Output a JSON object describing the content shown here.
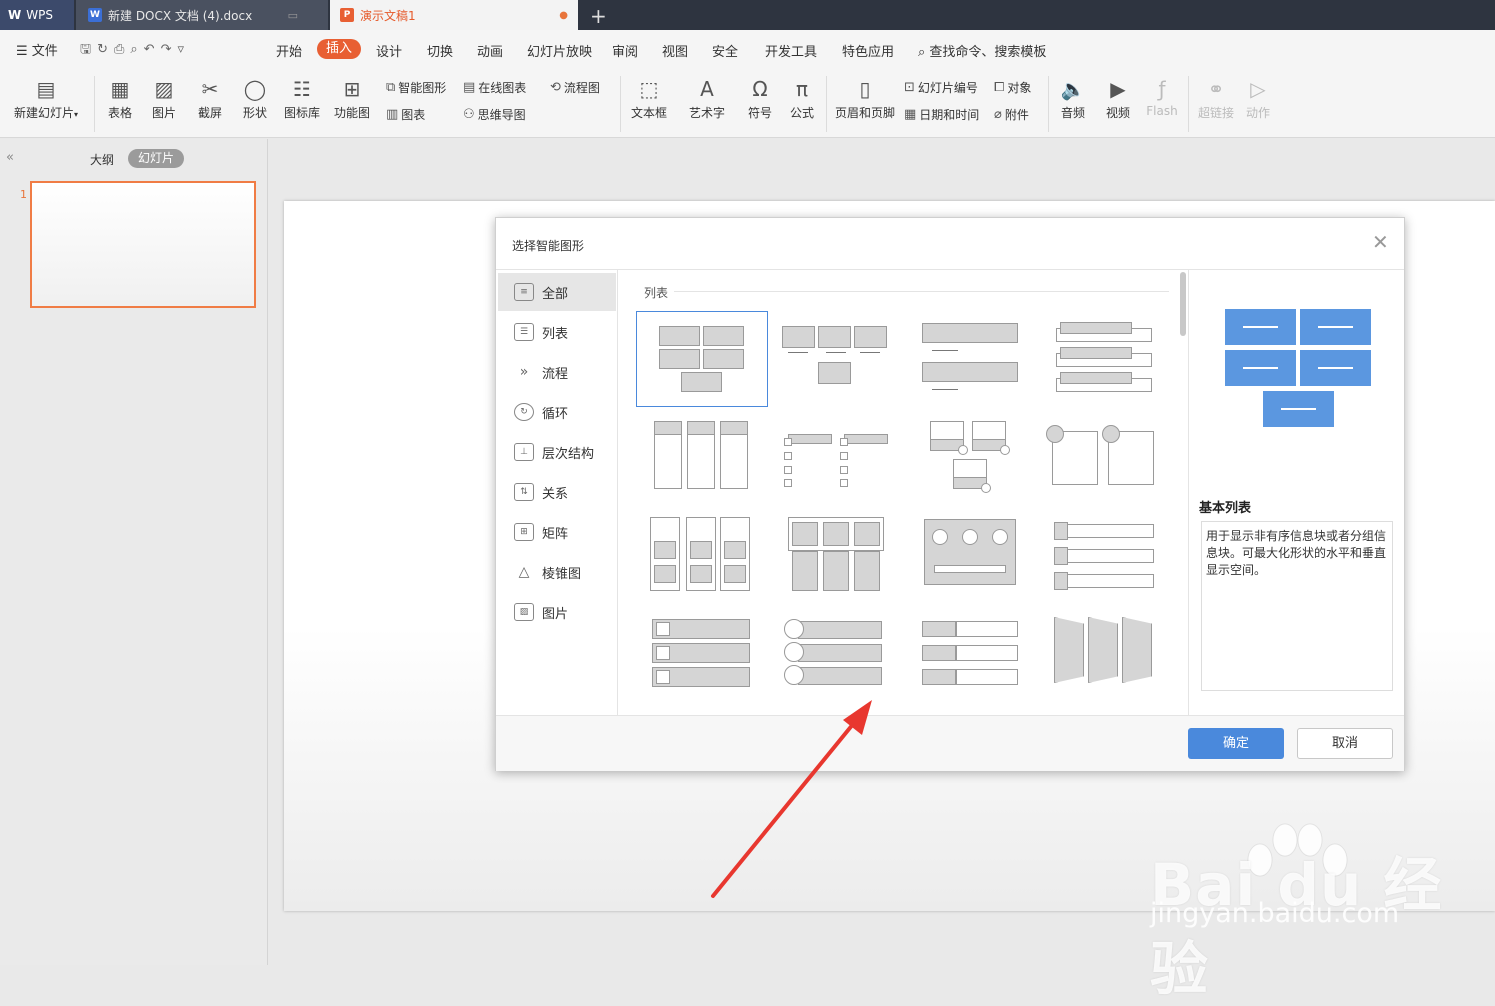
{
  "tabs": {
    "wps": "WPS",
    "doc": "新建 DOCX 文档 (4).docx",
    "ppt": "演示文稿1"
  },
  "menu": {
    "file": "文件",
    "items": [
      "开始",
      "插入",
      "设计",
      "切换",
      "动画",
      "幻灯片放映",
      "审阅",
      "视图",
      "安全",
      "开发工具",
      "特色应用"
    ],
    "search": "查找命令、搜索模板"
  },
  "ribbon": {
    "new_slide": "新建幻灯片",
    "table": "表格",
    "picture": "图片",
    "screenshot": "截屏",
    "shape": "形状",
    "icon_lib": "图标库",
    "func_chart": "功能图",
    "smart_art": "智能图形",
    "chart": "图表",
    "online_chart": "在线图表",
    "mind_map": "思维导图",
    "flowchart": "流程图",
    "textbox": "文本框",
    "word_art": "艺术字",
    "symbol": "符号",
    "formula": "公式",
    "header_footer": "页眉和页脚",
    "slide_number": "幻灯片编号",
    "date_time": "日期和时间",
    "object": "对象",
    "attachment": "附件",
    "audio": "音频",
    "video": "视频",
    "flash": "Flash",
    "hyperlink": "超链接",
    "action": "动作"
  },
  "left_panel": {
    "outline": "大纲",
    "slides": "幻灯片",
    "slide_number": "1"
  },
  "dialog": {
    "title": "选择智能图形",
    "categories": [
      "全部",
      "列表",
      "流程",
      "循环",
      "层次结构",
      "关系",
      "矩阵",
      "棱锥图",
      "图片"
    ],
    "section": "列表",
    "preview_name": "基本列表",
    "preview_desc": "用于显示非有序信息块或者分组信息块。可最大化形状的水平和垂直显示空间。",
    "ok": "确定",
    "cancel": "取消"
  },
  "watermark": {
    "logo": "Bai du 经验",
    "url": "jingyan.baidu.com"
  },
  "colors": {
    "accent": "#e85f33",
    "primary_button": "#4a89dc",
    "preview_shape": "#5b97e0",
    "arrow": "#e8372f"
  }
}
